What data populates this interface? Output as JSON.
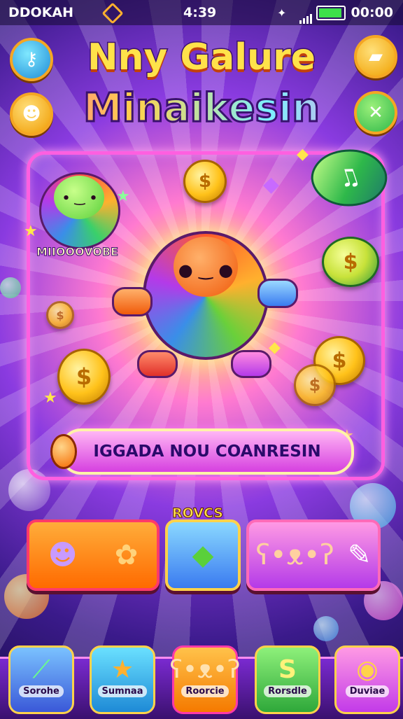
{
  "status_bar": {
    "carrier": "DDOKAH",
    "time_center": "4:39",
    "time_right": "00:00"
  },
  "title": {
    "line1": "Nny Galure",
    "line2": "Minaikesin"
  },
  "corner_buttons": {
    "top_left": "key-icon",
    "mid_left": "smile-icon",
    "top_right": "ticket-icon",
    "mid_right": "sword-icon"
  },
  "hero": {
    "companion_label": "MIIOOOVOBE",
    "coin_symbol": "$"
  },
  "cta": {
    "label": "IGGADA NOU COANRESIN"
  },
  "cards": {
    "label": "ROVCS"
  },
  "nav": [
    {
      "label": "Sorohe",
      "icon": "wand-icon"
    },
    {
      "label": "Sumnaa",
      "icon": "star-icon"
    },
    {
      "label": "Roorcie",
      "icon": "bear-icon"
    },
    {
      "label": "Rorsdle",
      "icon": "s-icon"
    },
    {
      "label": "Duviae",
      "icon": "target-icon"
    }
  ],
  "colors": {
    "frame": "#ff5fe0",
    "title_yellow": "#ffe24a",
    "coin_gold": "#ffc21a",
    "dock": "#7a2ad0"
  }
}
